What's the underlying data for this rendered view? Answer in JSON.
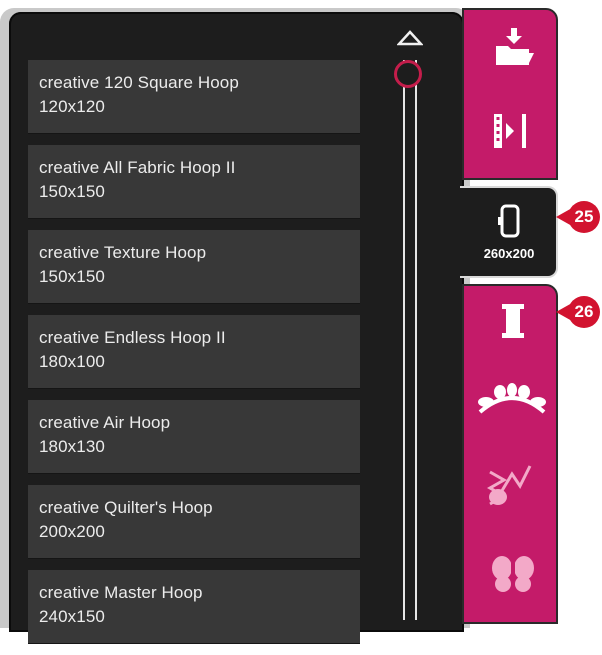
{
  "hoop_list": {
    "items": [
      {
        "name": "creative 120 Square Hoop",
        "size": "120x120"
      },
      {
        "name": "creative All Fabric Hoop II",
        "size": "150x150"
      },
      {
        "name": "creative Texture Hoop",
        "size": "150x150"
      },
      {
        "name": "creative Endless Hoop II",
        "size": "180x100"
      },
      {
        "name": "creative Air Hoop",
        "size": "180x130"
      },
      {
        "name": "creative Quilter's Hoop",
        "size": "200x200"
      },
      {
        "name": "creative Master Hoop",
        "size": "240x150"
      }
    ]
  },
  "scrollbar": {
    "up_icon": "triangle-up-icon",
    "position": 0
  },
  "side_tabs": {
    "upper_icons": [
      "open-folder-icon",
      "mirror-icon"
    ],
    "selected_hoop_label": "260x200",
    "selected_hoop_icon": "hoop-icon",
    "lower_icons": [
      "thread-spool-icon",
      "embroidery-design-icon",
      "stitch-icon",
      "butterfly-icon"
    ]
  },
  "callouts": {
    "hoop_tab": "25",
    "spool_tab": "26"
  },
  "colors": {
    "accent": "#c41b69",
    "panel": "#1d1d1d",
    "item_bg": "#383838",
    "callout": "#d2132f"
  }
}
